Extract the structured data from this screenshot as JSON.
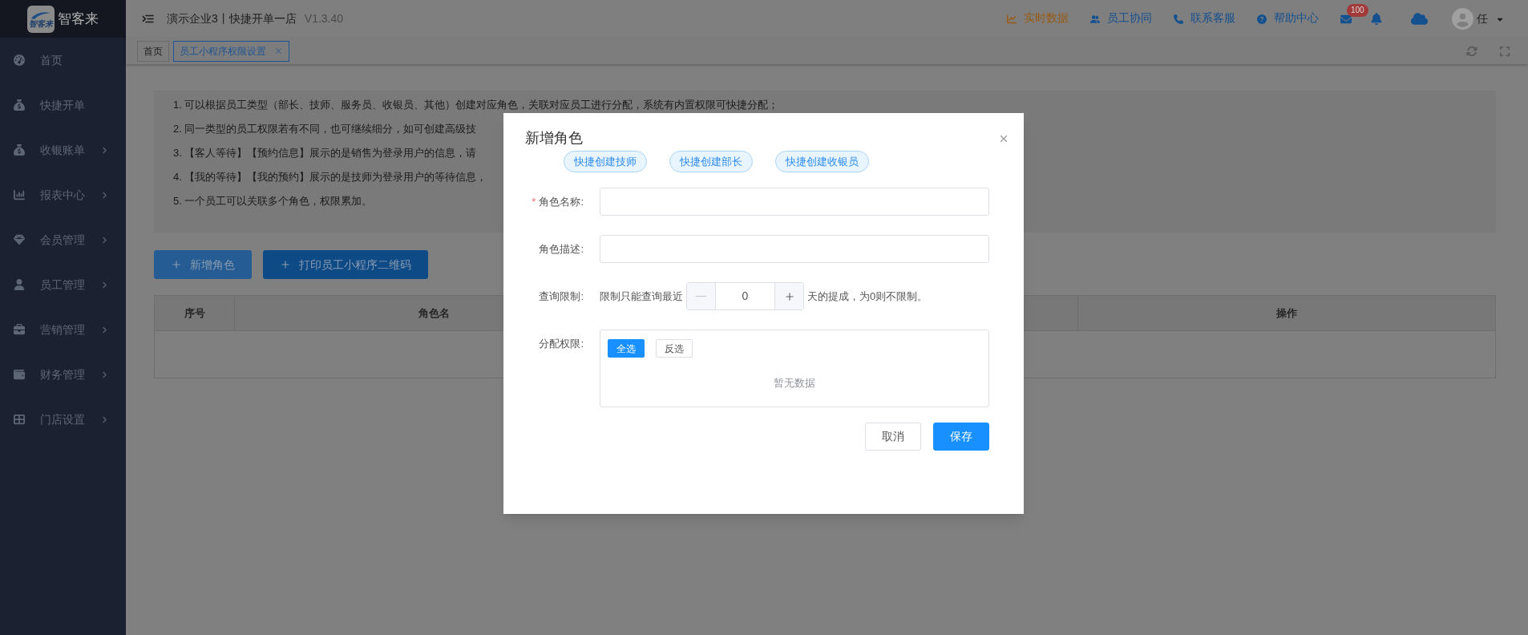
{
  "sidebar": {
    "logo_text": "智客来",
    "brand": "智客来",
    "items": [
      {
        "label": "首页",
        "kind": "dashboard",
        "has_children": false
      },
      {
        "label": "快捷开单",
        "kind": "order",
        "has_children": false
      },
      {
        "label": "收银账单",
        "kind": "billing",
        "has_children": true
      },
      {
        "label": "报表中心",
        "kind": "report",
        "has_children": true
      },
      {
        "label": "会员管理",
        "kind": "member",
        "has_children": true
      },
      {
        "label": "员工管理",
        "kind": "staff",
        "has_children": true
      },
      {
        "label": "营销管理",
        "kind": "marketing",
        "has_children": true
      },
      {
        "label": "财务管理",
        "kind": "finance",
        "has_children": true
      },
      {
        "label": "门店设置",
        "kind": "store",
        "has_children": true
      }
    ]
  },
  "topbar": {
    "title": "演示企业3丨快捷开单一店",
    "version": "V1.3.40",
    "links": [
      {
        "label": "实时数据",
        "kind": "realtime"
      },
      {
        "label": "员工协同",
        "kind": "team"
      },
      {
        "label": "联系客服",
        "kind": "phone"
      },
      {
        "label": "帮助中心",
        "kind": "help"
      }
    ],
    "mail_badge": "100",
    "user": "任"
  },
  "tabs": [
    {
      "label": "首页",
      "selected": false,
      "closable": false
    },
    {
      "label": "员工小程序权限设置",
      "selected": true,
      "closable": true
    }
  ],
  "notes": [
    "1. 可以根据员工类型（部长、技师、服务员、收银员、其他）创建对应角色，关联对应员工进行分配，系统有内置权限可快捷分配；",
    "2. 同一类型的员工权限若有不同，也可继续细分，如可创建高级技",
    "3. 【客人等待】【预约信息】展示的是销售为登录用户的信息，请",
    "4. 【我的等待】【我的预约】展示的是技师为登录用户的等待信息，",
    "5. 一个员工可以关联多个角色，权限累加。"
  ],
  "actions": [
    {
      "label": "新增角色",
      "kind": "light"
    },
    {
      "label": "打印员工小程序二维码",
      "kind": "dark"
    }
  ],
  "table": {
    "columns": [
      "序号",
      "角色名",
      "操作"
    ]
  },
  "dialog": {
    "title": "新增角色",
    "quick_buttons": [
      "快捷创建技师",
      "快捷创建部长",
      "快捷创建收银员"
    ],
    "fields": [
      {
        "label": "角色名称:",
        "required_mark": "*"
      },
      {
        "label": "角色描述:"
      }
    ],
    "query_limit": {
      "label": "查询限制:",
      "prefix": "限制只能查询最近",
      "value": "0",
      "suffix": "天的提成，为0则不限制。"
    },
    "permissions": {
      "label": "分配权限:",
      "buttons": [
        {
          "label": "全选",
          "selected": true
        },
        {
          "label": "反选",
          "selected": false
        }
      ],
      "empty": "暂无数据"
    },
    "footer": [
      {
        "label": "取消",
        "kind": "default"
      },
      {
        "label": "保存",
        "kind": "primary"
      }
    ]
  }
}
